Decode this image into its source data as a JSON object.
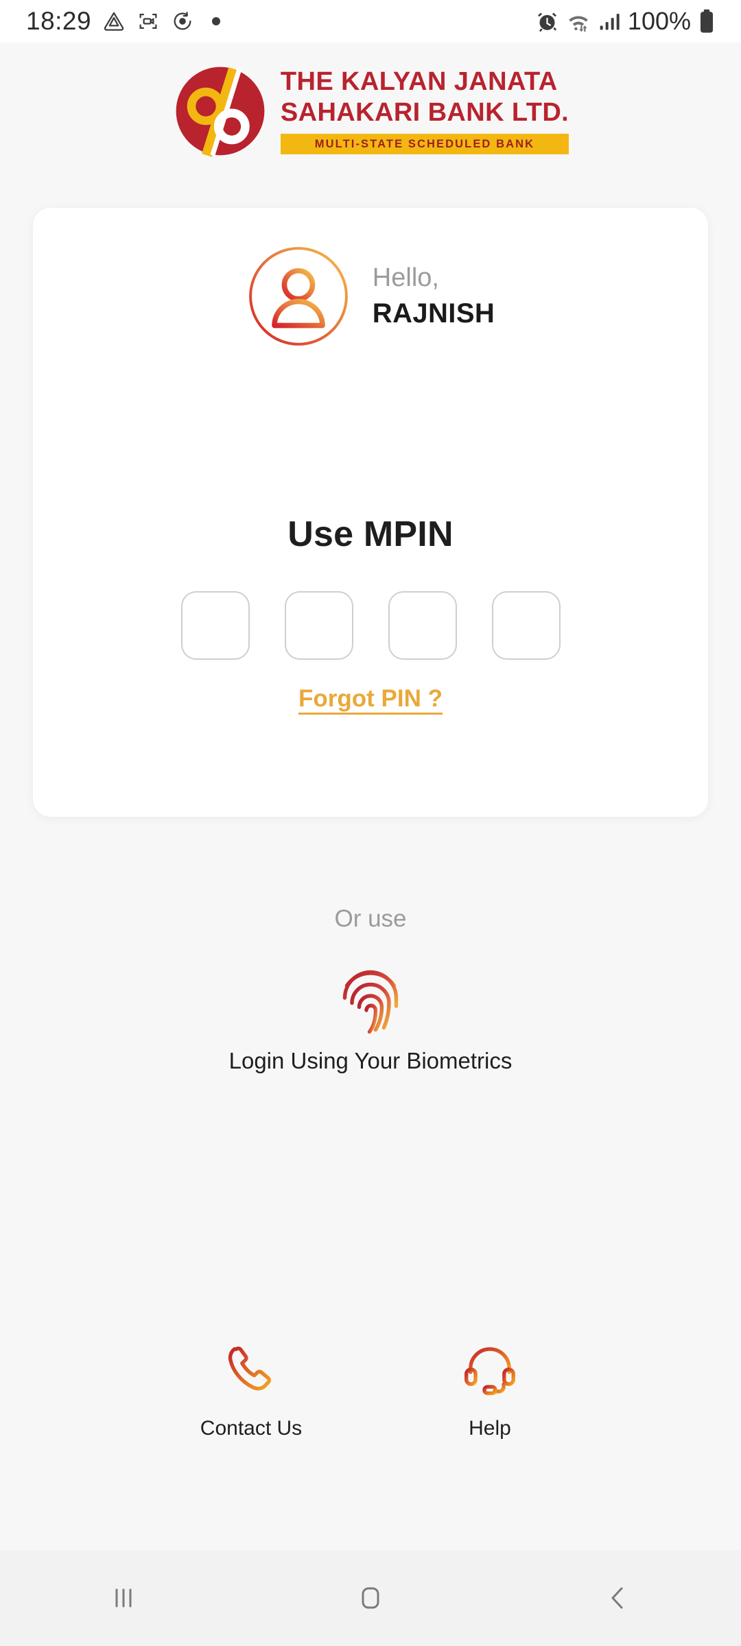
{
  "status_bar": {
    "time": "18:29",
    "battery_percent": "100%",
    "left_icons": [
      "drive-triangle-icon",
      "screen-record-icon",
      "sleep-mode-icon",
      "notification-dot-icon"
    ],
    "right_icons": [
      "alarm-icon",
      "wifi-icon",
      "signal-bars-icon",
      "battery-icon"
    ]
  },
  "logo": {
    "line1": "THE KALYAN JANATA",
    "line2": "SAHAKARI BANK LTD.",
    "tagline": "MULTI-STATE SCHEDULED BANK",
    "mark_name": "kjsb-dp-monogram-icon"
  },
  "card": {
    "greeting": "Hello,",
    "user_name": "RAJNISH",
    "mpin_title": "Use MPIN",
    "pin_boxes": [
      {
        "value": "",
        "placeholder": ""
      },
      {
        "value": "",
        "placeholder": ""
      },
      {
        "value": "",
        "placeholder": ""
      },
      {
        "value": "",
        "placeholder": ""
      }
    ],
    "forgot_link": "Forgot PIN ?"
  },
  "alternate": {
    "or_use": "Or use",
    "biometric_label": "Login Using Your Biometrics",
    "biometric_icon": "fingerprint-icon"
  },
  "bottom_actions": [
    {
      "label": "Contact Us",
      "icon": "phone-icon"
    },
    {
      "label": "Help",
      "icon": "headset-icon"
    }
  ],
  "nav_bar": {
    "recents": "recents-icon",
    "home": "home-icon",
    "back": "back-icon"
  },
  "colors": {
    "brand_red": "#B8232E",
    "brand_gold": "#F2B711",
    "link_gold": "#E9A83A",
    "gradient_start": "#D6232B",
    "gradient_end": "#F5A623",
    "page_bg": "#F7F7F7",
    "card_bg": "#FFFFFF",
    "pin_border": "#CFCFCF",
    "muted_text": "#9B9B9B",
    "nav_bg": "#F2F2F2"
  }
}
